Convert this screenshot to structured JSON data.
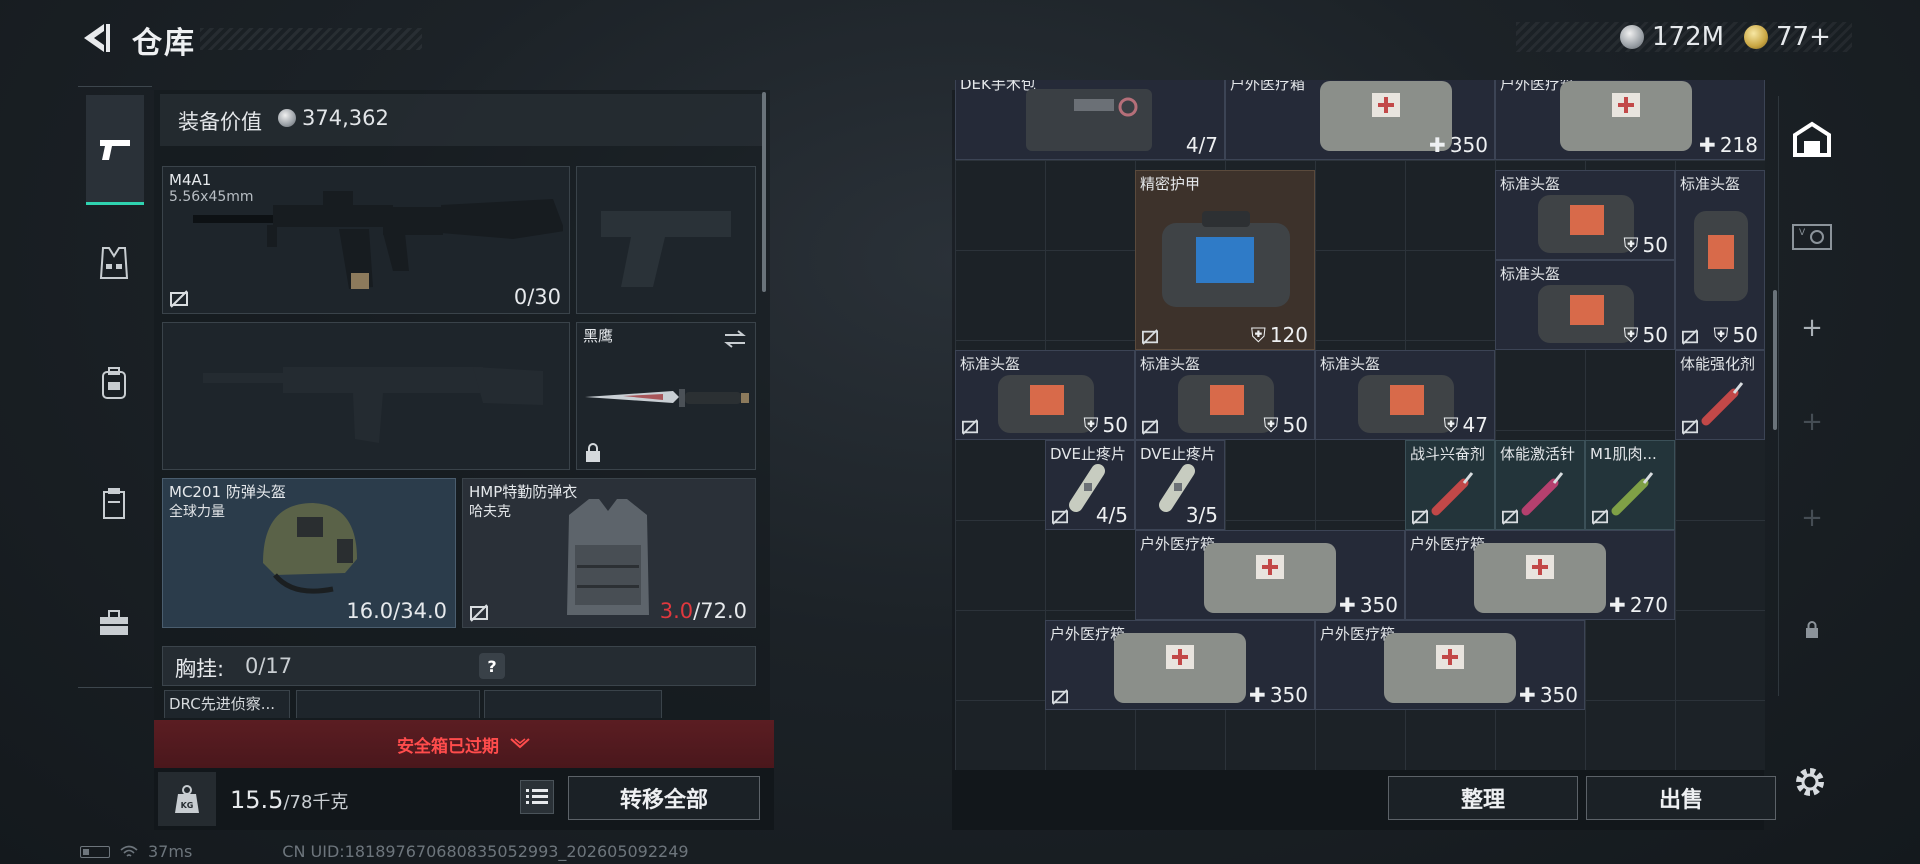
{
  "header": {
    "title": "仓库"
  },
  "currency": {
    "silver": "172M",
    "gold": "77+"
  },
  "equipment": {
    "value_label": "装备价值",
    "value": "374,362",
    "primary_weapon": {
      "name": "M4A1",
      "caliber": "5.56x45mm",
      "ammo": "0/30"
    },
    "melee": {
      "name": "黑鹰"
    },
    "helmet": {
      "name": "MC201 防弹头盔",
      "brand": "全球力量",
      "durability": "16.0/34.0"
    },
    "armor": {
      "name": "HMP特勤防弹衣",
      "brand": "哈夫克",
      "durability_current": "3.0",
      "durability_max": "/72.0"
    },
    "chest_rig": {
      "label": "胸挂:",
      "count": "0/17",
      "help": "?"
    },
    "chest_items": [
      "DRC先进侦察...",
      "",
      ""
    ]
  },
  "warning": {
    "text": "安全箱已过期"
  },
  "weight": {
    "current": "15.5",
    "max": "/78千克"
  },
  "buttons": {
    "transfer_all": "转移全部",
    "sort": "整理",
    "sell": "出售"
  },
  "status": {
    "ping": "37ms",
    "uid": "CN UID:1818976706808350529​93_202605092249"
  },
  "storage_items": [
    {
      "name": "DEK手术包",
      "value": "4/7",
      "icon": "surgical-kit-icon"
    },
    {
      "name": "户外医疗箱",
      "value": "350",
      "icon": "medkit-icon"
    },
    {
      "name": "户外医疗箱",
      "value": "218",
      "icon": "medkit-icon"
    },
    {
      "name": "精密护甲",
      "value": "120",
      "icon": "armor-bag-icon"
    },
    {
      "name": "标准头盔",
      "value": "50",
      "icon": "helmet-bag-icon"
    },
    {
      "name": "标准头盔",
      "value": "50",
      "icon": "helmet-bag-icon"
    },
    {
      "name": "标准头盔",
      "value": "50",
      "icon": "helmet-bag-icon"
    },
    {
      "name": "标准头盔",
      "value": "50",
      "icon": "helmet-bag-icon"
    },
    {
      "name": "标准头盔",
      "value": "50",
      "icon": "helmet-bag-icon"
    },
    {
      "name": "标准头盔",
      "value": "47",
      "icon": "helmet-bag-icon"
    },
    {
      "name": "体能强化剂",
      "value": "",
      "icon": "injector-icon"
    },
    {
      "name": "DVE止疼片",
      "value": "4/5",
      "icon": "painkiller-icon"
    },
    {
      "name": "DVE止疼片",
      "value": "3/5",
      "icon": "painkiller-icon"
    },
    {
      "name": "战斗兴奋剂",
      "value": "",
      "icon": "injector-icon"
    },
    {
      "name": "体能激活针",
      "value": "",
      "icon": "injector-icon"
    },
    {
      "name": "M1肌肉...",
      "value": "",
      "icon": "injector-icon"
    },
    {
      "name": "户外医疗箱",
      "value": "350",
      "icon": "medkit-icon"
    },
    {
      "name": "户外医疗箱",
      "value": "270",
      "icon": "medkit-icon"
    },
    {
      "name": "户外医疗箱",
      "value": "350",
      "icon": "medkit-icon"
    },
    {
      "name": "户外医疗箱",
      "value": "350",
      "icon": "medkit-icon"
    }
  ]
}
